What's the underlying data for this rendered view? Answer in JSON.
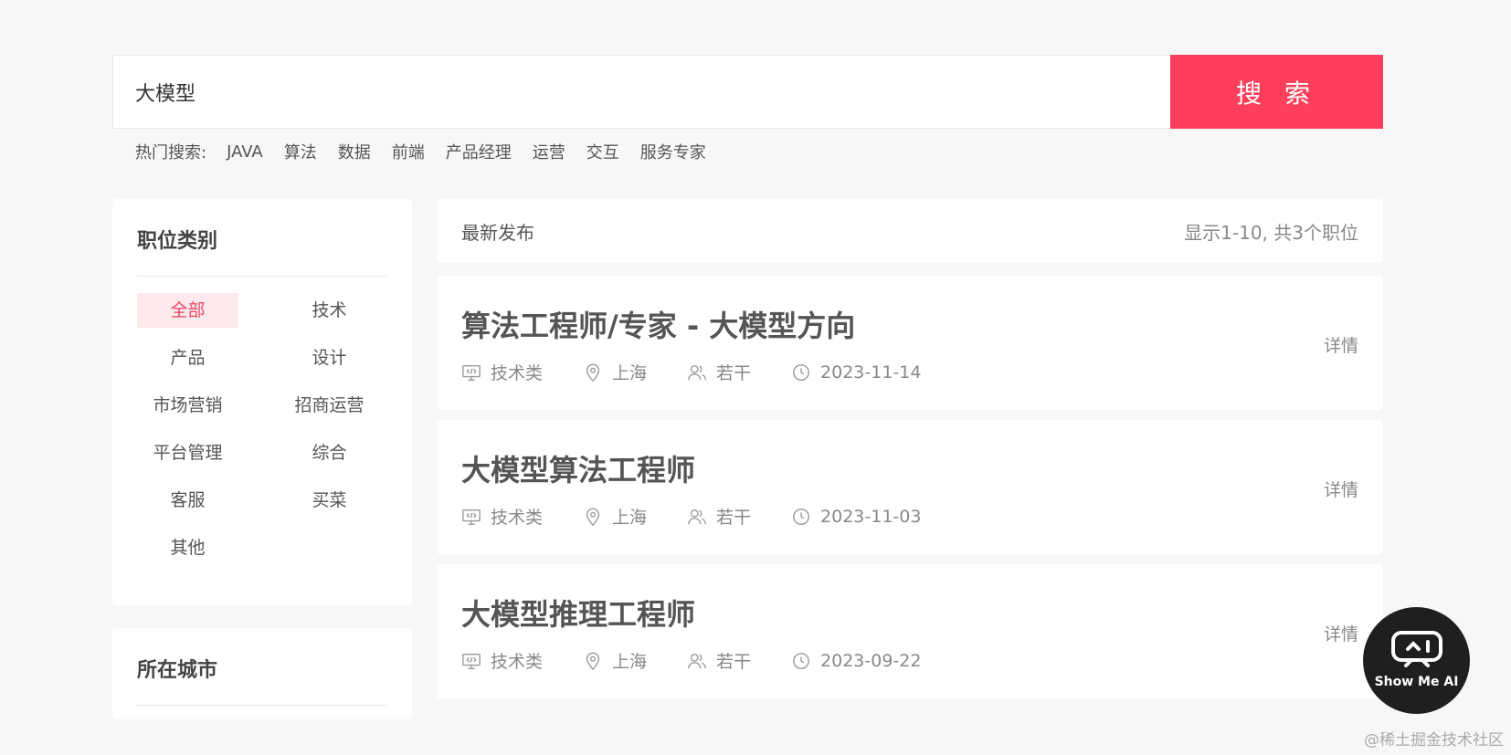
{
  "search": {
    "value": "大模型",
    "button_label": "搜 索"
  },
  "hot_search": {
    "label": "热门搜索:",
    "items": [
      "JAVA",
      "算法",
      "数据",
      "前端",
      "产品经理",
      "运营",
      "交互",
      "服务专家"
    ]
  },
  "categories": {
    "title": "职位类别",
    "items": [
      "全部",
      "技术",
      "产品",
      "设计",
      "市场营销",
      "招商运营",
      "平台管理",
      "综合",
      "客服",
      "买菜",
      "其他"
    ],
    "active_index": 0
  },
  "city": {
    "title": "所在城市"
  },
  "list_header": {
    "sort_label": "最新发布",
    "count_text": "显示1-10, 共3个职位"
  },
  "jobs": [
    {
      "title": "算法工程师/专家 - 大模型方向",
      "category": "技术类",
      "city": "上海",
      "headcount": "若干",
      "date": "2023-11-14",
      "detail": "详情"
    },
    {
      "title": "大模型算法工程师",
      "category": "技术类",
      "city": "上海",
      "headcount": "若干",
      "date": "2023-11-03",
      "detail": "详情"
    },
    {
      "title": "大模型推理工程师",
      "category": "技术类",
      "city": "上海",
      "headcount": "若干",
      "date": "2023-09-22",
      "detail": "详情"
    }
  ],
  "ai_badge": {
    "label": "Show Me AI"
  },
  "watermark": "@稀土掘金技术社区",
  "colors": {
    "accent": "#fd3f5b",
    "active_bg": "#ffe9ec",
    "active_text": "#e84660"
  }
}
